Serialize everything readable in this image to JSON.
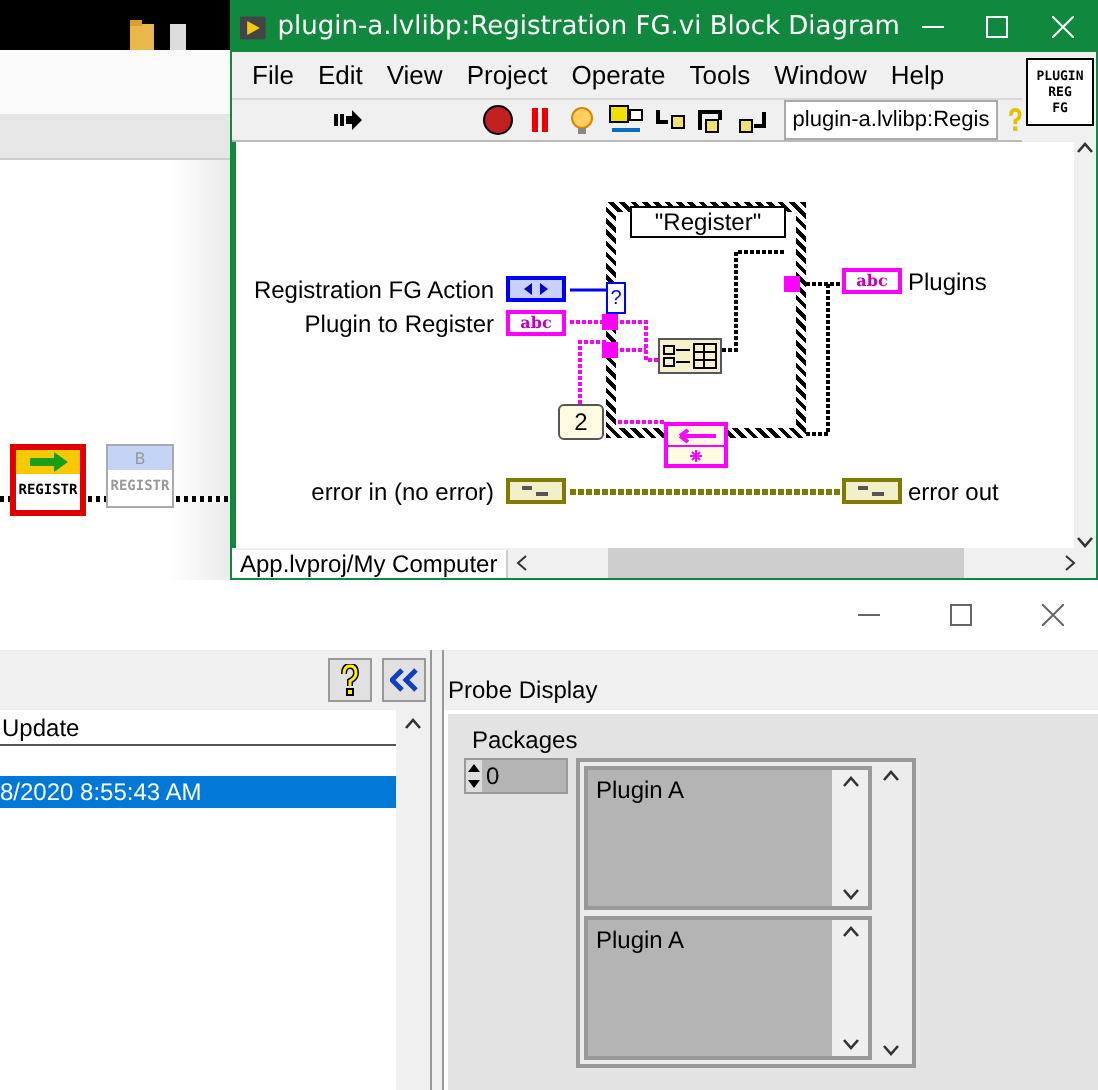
{
  "background_window": {
    "nodes": [
      {
        "label": "REGISTR",
        "selected": true
      },
      {
        "label": "REGISTR",
        "badge": "B",
        "selected": false
      }
    ]
  },
  "block_diagram_window": {
    "title": "plugin-a.lvlibp:Registration FG.vi Block Diagram",
    "menu": [
      "File",
      "Edit",
      "View",
      "Project",
      "Operate",
      "Tools",
      "Window",
      "Help"
    ],
    "context_path": "plugin-a.lvlibp:Regis",
    "vi_icon_lines": [
      "PLUGIN",
      "REG",
      "FG"
    ],
    "diagram": {
      "case_selector": "\"Register\"",
      "selector_terminal": "?",
      "controls": [
        {
          "label": "Registration FG Action",
          "kind": "enum"
        },
        {
          "label": "Plugin to Register",
          "kind": "string",
          "glyph": "abc"
        },
        {
          "label": "error in (no error)",
          "kind": "error"
        }
      ],
      "indicators": [
        {
          "label": "Plugins",
          "kind": "string",
          "glyph": "abc"
        },
        {
          "label": "error out",
          "kind": "error"
        }
      ],
      "constant": "2"
    },
    "status_bar": "App.lvproj/My Computer"
  },
  "probe_window": {
    "table": {
      "columns": [
        "Update"
      ],
      "rows": [
        {
          "update": "8/2020 8:55:43 AM",
          "selected": true
        }
      ]
    },
    "probe_display": {
      "title": "Probe Display",
      "array_label": "Packages",
      "index": "0",
      "elements": [
        "Plugin A",
        "Plugin A"
      ]
    }
  }
}
